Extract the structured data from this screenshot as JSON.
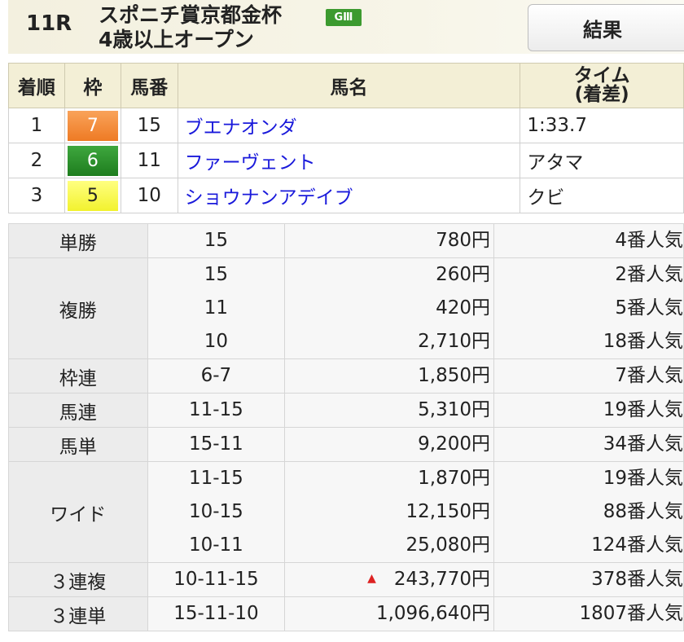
{
  "race": {
    "number": "11R",
    "name": "スポニチ賞京都金杯",
    "grade": "GⅢ",
    "condition": "4歳以上オープン"
  },
  "result_button": "結果",
  "results": {
    "headers": [
      "着順",
      "枠",
      "馬番",
      "馬名",
      "タイム",
      "(着差)"
    ],
    "rows": [
      {
        "rank": "1",
        "waku": "7",
        "umaban": "15",
        "horse": "ブエナオンダ",
        "time": "1:33.7"
      },
      {
        "rank": "2",
        "waku": "6",
        "umaban": "11",
        "horse": "ファーヴェント",
        "time": "アタマ"
      },
      {
        "rank": "3",
        "waku": "5",
        "umaban": "10",
        "horse": "ショウナンアデイブ",
        "time": "クビ"
      }
    ]
  },
  "payouts": [
    {
      "type": "単勝",
      "lines": [
        {
          "combo": "15",
          "pay": "780円",
          "pop": "4番人気"
        }
      ]
    },
    {
      "type": "複勝",
      "lines": [
        {
          "combo": "15",
          "pay": "260円",
          "pop": "2番人気"
        },
        {
          "combo": "11",
          "pay": "420円",
          "pop": "5番人気"
        },
        {
          "combo": "10",
          "pay": "2,710円",
          "pop": "18番人気"
        }
      ]
    },
    {
      "type": "枠連",
      "lines": [
        {
          "combo": "6-7",
          "pay": "1,850円",
          "pop": "7番人気"
        }
      ]
    },
    {
      "type": "馬連",
      "lines": [
        {
          "combo": "11-15",
          "pay": "5,310円",
          "pop": "19番人気"
        }
      ]
    },
    {
      "type": "馬単",
      "lines": [
        {
          "combo": "15-11",
          "pay": "9,200円",
          "pop": "34番人気"
        }
      ]
    },
    {
      "type": "ワイド",
      "lines": [
        {
          "combo": "11-15",
          "pay": "1,870円",
          "pop": "19番人気"
        },
        {
          "combo": "10-15",
          "pay": "12,150円",
          "pop": "88番人気"
        },
        {
          "combo": "10-11",
          "pay": "25,080円",
          "pop": "124番人気"
        }
      ]
    },
    {
      "type": "３連複",
      "lines": [
        {
          "combo": "10-11-15",
          "pay": "243,770円",
          "pop": "378番人気",
          "mark": "▲"
        }
      ]
    },
    {
      "type": "３連単",
      "lines": [
        {
          "combo": "15-11-10",
          "pay": "1,096,640円",
          "pop": "1807番人気"
        }
      ]
    }
  ],
  "colors": {
    "waku7": "#ee7a24",
    "waku6": "#1e7d1e",
    "waku5": "#f2f22e",
    "link": "#1a1adb",
    "grade_badge": "#3c9a2f"
  }
}
